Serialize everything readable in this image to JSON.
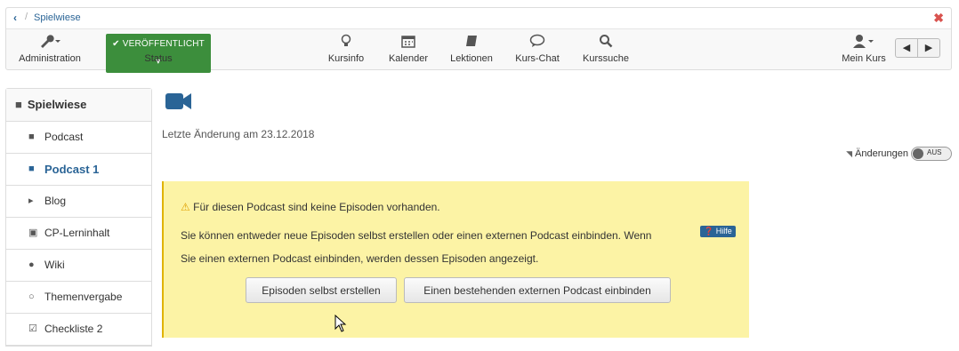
{
  "breadcrumb": {
    "back": "‹",
    "separator": "/",
    "link": "Spielwiese"
  },
  "toolbar": {
    "administration": "Administration",
    "status_badge": "VERÖFFENTLICHT",
    "status_label": "Status",
    "kursinfo": "Kursinfo",
    "kalender": "Kalender",
    "lektionen": "Lektionen",
    "kurs_chat": "Kurs-Chat",
    "kurssuche": "Kurssuche",
    "mein_kurs": "Mein Kurs"
  },
  "sidebar": {
    "title": "Spielwiese",
    "items": [
      {
        "label": "Podcast",
        "icon": "video-icon"
      },
      {
        "label": "Podcast 1",
        "icon": "video-icon",
        "active": true
      },
      {
        "label": "Blog",
        "icon": "bullhorn-icon"
      },
      {
        "label": "CP-Lerninhalt",
        "icon": "archive-icon"
      },
      {
        "label": "Wiki",
        "icon": "globe-icon"
      },
      {
        "label": "Themenvergabe",
        "icon": "circle-icon"
      },
      {
        "label": "Checkliste 2",
        "icon": "checkbox-icon"
      }
    ]
  },
  "main": {
    "last_modified": "Letzte Änderung am 23.12.2018",
    "changes_label": "Änderungen",
    "toggle_label": "AUS",
    "alert": {
      "title": "Für diesen Podcast sind keine Episoden vorhanden.",
      "line1": "Sie können entweder neue Episoden selbst erstellen oder einen externen Podcast einbinden. Wenn",
      "line2": "Sie einen externen Podcast einbinden, werden dessen Episoden angezeigt.",
      "help": "Hilfe",
      "button_create": "Episoden selbst erstellen",
      "button_embed": "Einen bestehenden externen Podcast einbinden"
    }
  },
  "colors": {
    "accent": "#2a6496",
    "status": "#3c8e3c",
    "alert_bg": "#fcf3a5"
  }
}
